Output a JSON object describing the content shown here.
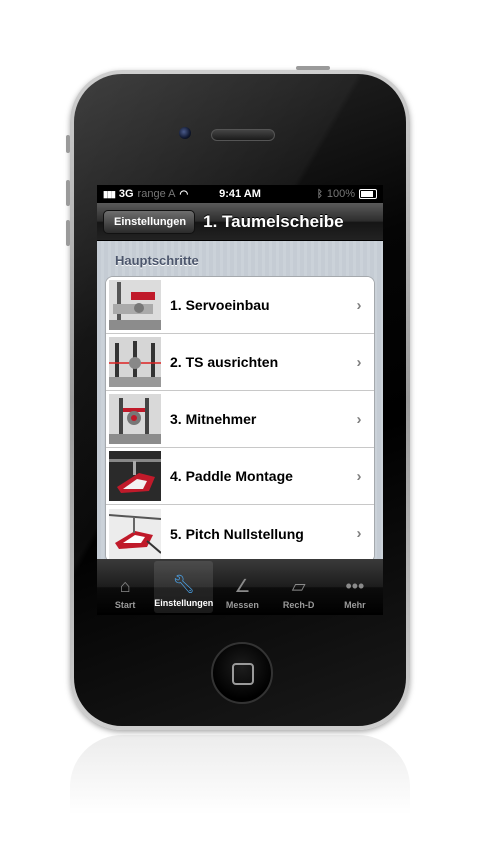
{
  "status_bar": {
    "carrier": "3G",
    "carrier_name": "range A",
    "time": "9:41 AM",
    "battery": "100%"
  },
  "nav": {
    "back_label": "Einstellungen",
    "title": "1. Taumelscheibe"
  },
  "section": {
    "header": "Hauptschritte"
  },
  "rows": [
    {
      "label": "1. Servoeinbau",
      "thumb": "servo-thumb"
    },
    {
      "label": "2. TS ausrichten",
      "thumb": "swashplate-thumb"
    },
    {
      "label": "3. Mitnehmer",
      "thumb": "driver-thumb"
    },
    {
      "label": "4. Paddle Montage",
      "thumb": "paddle-thumb"
    },
    {
      "label": "5. Pitch Nullstellung",
      "thumb": "heli-thumb"
    }
  ],
  "tabs": [
    {
      "label": "Start",
      "icon": "home-icon",
      "active": false
    },
    {
      "label": "Einstellungen",
      "icon": "wrench-icon",
      "active": true
    },
    {
      "label": "Messen",
      "icon": "protractor-icon",
      "active": false
    },
    {
      "label": "Rech-D",
      "icon": "ruler-icon",
      "active": false
    },
    {
      "label": "Mehr",
      "icon": "more-icon",
      "active": false
    }
  ],
  "colors": {
    "tab_active": "#4ba3e9",
    "section_header": "#4c566c",
    "table_bg": "#ffffff"
  }
}
